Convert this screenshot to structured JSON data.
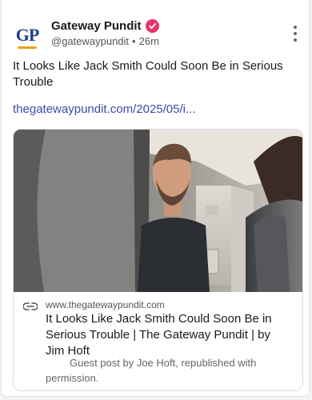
{
  "post": {
    "author_name": "Gateway Pundit",
    "avatar_text": "GP",
    "handle": "@gatewaypundit",
    "separator": "•",
    "time": "26m",
    "text": "It Looks Like Jack Smith Could Soon Be in Serious Trouble",
    "link_text": "thegatewaypundit.com/2025/05/i..."
  },
  "preview": {
    "domain": "www.thegatewaypundit.com",
    "title": "It Looks Like Jack Smith Could Soon Be in Serious Trouble | The Gateway Pundit | by Jim Hoft",
    "description": "Guest post by Joe Hoft, republished with permission."
  },
  "colors": {
    "verified": "#e8336b",
    "link": "#3b4ba8",
    "avatar_blue": "#1f3f8a",
    "avatar_gold": "#e8a317"
  },
  "icons": [
    "verified-badge-icon",
    "more-options-icon",
    "link-icon"
  ]
}
